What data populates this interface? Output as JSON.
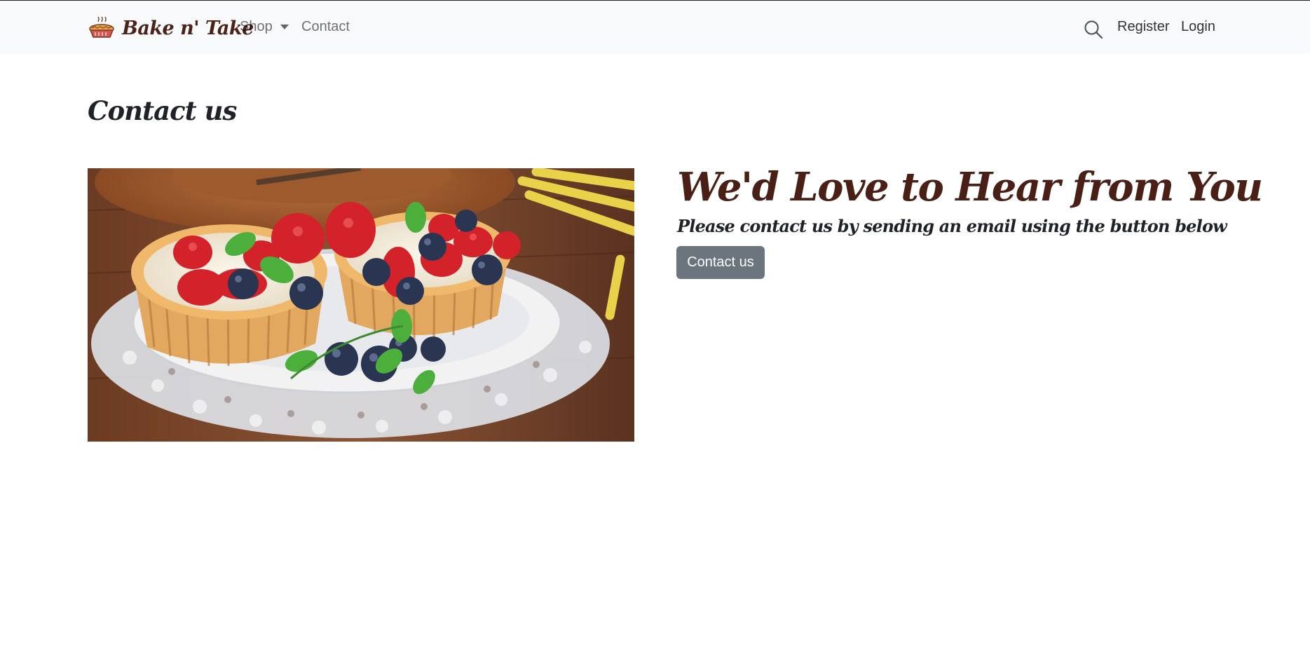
{
  "nav": {
    "brand": "Bake n' Take",
    "shop_label": "Shop",
    "contact_label": "Contact",
    "register_label": "Register",
    "login_label": "Login"
  },
  "page": {
    "title": "Contact us"
  },
  "content": {
    "headline": "We'd Love to Hear from You",
    "subline": "Please contact us by sending an email using the button below",
    "button_label": "Contact us"
  },
  "icons": {
    "brand": "pie-logo-icon",
    "search": "search-icon",
    "dropdown": "chevron-down-icon"
  },
  "colors": {
    "navbar_bg": "#f8f9fa",
    "brand_text": "#4a2318",
    "headline": "#4a1f16",
    "button_bg": "#6c757d",
    "button_text": "#ffffff"
  }
}
